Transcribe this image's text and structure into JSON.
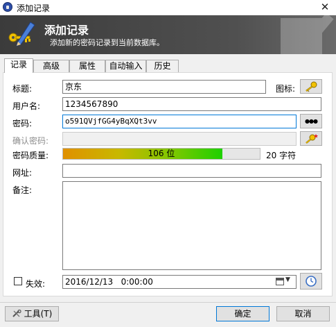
{
  "window": {
    "title": "添加记录",
    "close_glyph": "✕"
  },
  "banner": {
    "title": "添加记录",
    "subtitle": "添加新的密码记录到当前数据库。"
  },
  "tabs": [
    {
      "label": "记录",
      "active": true
    },
    {
      "label": "高级"
    },
    {
      "label": "属性"
    },
    {
      "label": "自动输入"
    },
    {
      "label": "历史"
    }
  ],
  "form": {
    "title_label": "标题:",
    "title_value": "京东",
    "icon_label": "图标:",
    "username_label": "用户名:",
    "username_value": "1234567890",
    "password_label": "密码:",
    "password_value": "o591QVjfGG4yBqXQt3vv",
    "show_password_glyph": "●●●",
    "confirm_label": "确认密码:",
    "quality_label": "密码质量:",
    "quality_text": "106 位",
    "quality_fraction": 0.81,
    "chars_text": "20 字符",
    "url_label": "网址:",
    "url_value": "",
    "notes_label": "备注:",
    "notes_value": "",
    "expires_label": "失效:",
    "expires_checked": false,
    "expires_value": "2016/12/13   0:00:00"
  },
  "footer": {
    "tools_label": "工具(T)",
    "ok_label": "确定",
    "cancel_label": "取消"
  },
  "colors": {
    "banner_bg": "#3b3b3b",
    "quality_start": "#e09000",
    "quality_end": "#1ed000",
    "focus": "#0078d7"
  }
}
